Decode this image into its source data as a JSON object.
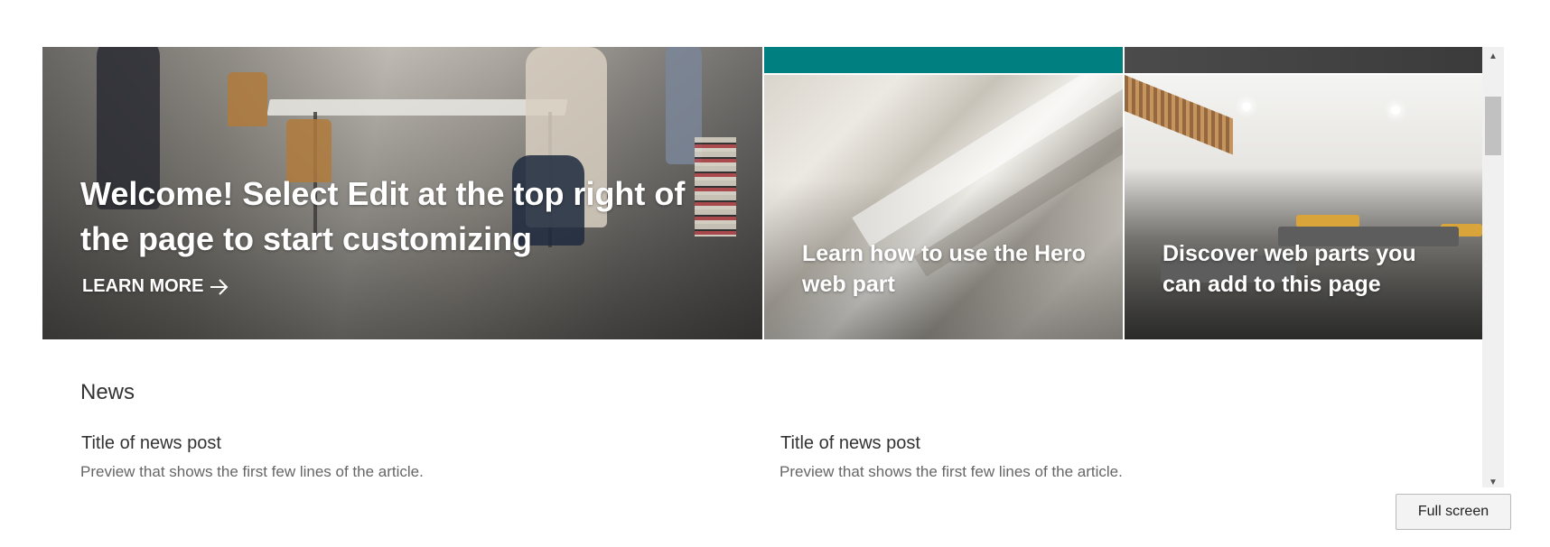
{
  "hero": {
    "main_tile": {
      "title": "Welcome! Select Edit at the top right of the page to start customizing",
      "link_label": "LEARN MORE",
      "link_icon": "arrow-right-icon"
    },
    "tiles": [
      {
        "title": "Learn how to use the Hero web part"
      },
      {
        "title": "Discover web parts you can add to this page"
      }
    ],
    "accent_color": "#007f80"
  },
  "news": {
    "heading": "News",
    "items": [
      {
        "title": "Title of news post",
        "preview": "Preview that shows the first few lines of the article."
      },
      {
        "title": "Title of news post",
        "preview": "Preview that shows the first few lines of the article."
      }
    ]
  },
  "scrollbar": {
    "up_icon": "triangle-up-icon",
    "down_icon": "triangle-down-icon"
  },
  "fullscreen_button": {
    "label": "Full screen"
  }
}
